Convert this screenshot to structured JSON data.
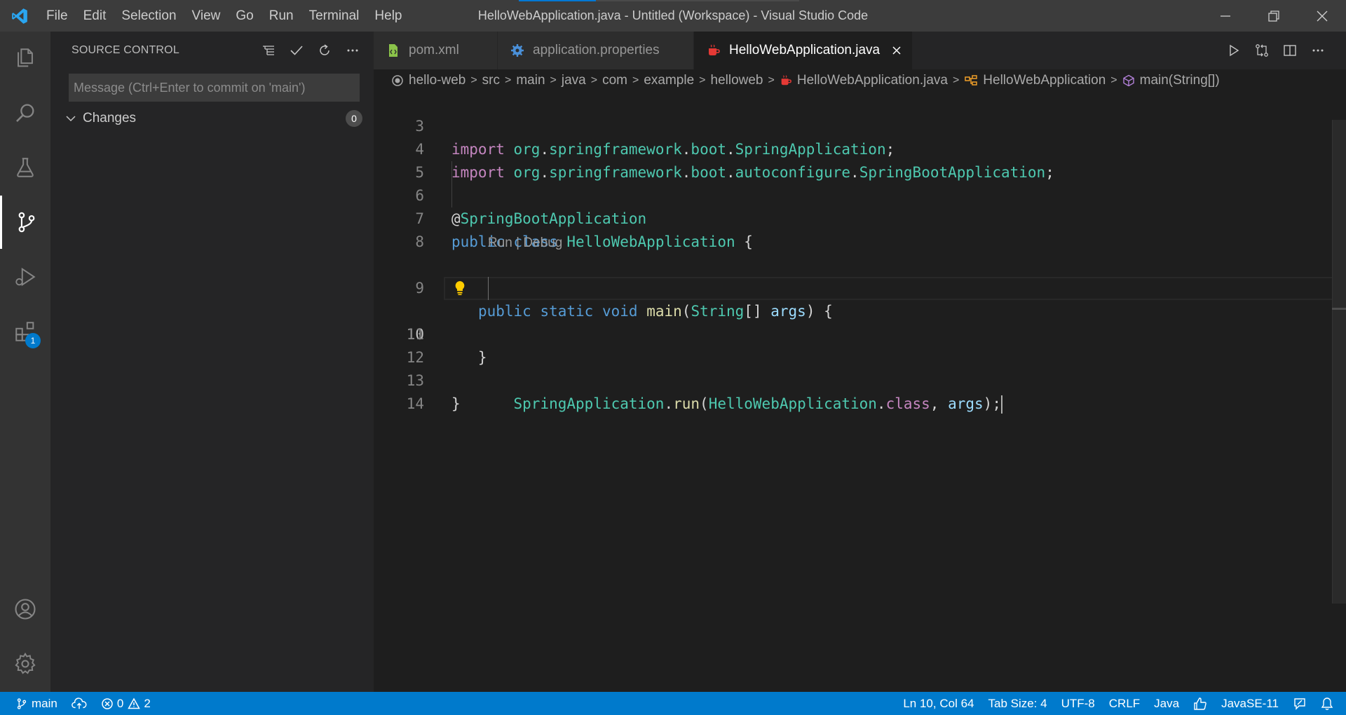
{
  "window": {
    "title": "HelloWebApplication.java - Untitled (Workspace) - Visual Studio Code",
    "menu": [
      "File",
      "Edit",
      "Selection",
      "View",
      "Go",
      "Run",
      "Terminal",
      "Help"
    ]
  },
  "activity_bar": {
    "extensions_badge": "1"
  },
  "sidebar": {
    "title": "SOURCE CONTROL",
    "commit_placeholder": "Message (Ctrl+Enter to commit on 'main')",
    "changes_label": "Changes",
    "changes_count": "0"
  },
  "tabs": [
    {
      "label": "pom.xml",
      "icon": "xml-file-icon"
    },
    {
      "label": "application.properties",
      "icon": "gear-icon"
    },
    {
      "label": "HelloWebApplication.java",
      "icon": "java-file-icon",
      "active": true
    }
  ],
  "breadcrumbs": [
    "hello-web",
    "src",
    "main",
    "java",
    "com",
    "example",
    "helloweb",
    "HelloWebApplication.java",
    "HelloWebApplication",
    "main(String[])"
  ],
  "editor": {
    "line_numbers": [
      "3",
      "4",
      "5",
      "6",
      "7",
      "8",
      "9",
      "10",
      "11",
      "12",
      "13",
      "14"
    ],
    "codelens": "Run | Debug",
    "current_line": "10"
  },
  "status": {
    "branch": "main",
    "errors": "0",
    "warnings": "2",
    "position": "Ln 10, Col 64",
    "tab_size": "Tab Size: 4",
    "encoding": "UTF-8",
    "eol": "CRLF",
    "language": "Java",
    "runtime": "JavaSE-11"
  },
  "colors": {
    "accent": "#007acc",
    "keyword": "#569cd6",
    "type": "#4ec9b0",
    "function": "#dcdcaa",
    "variable": "#9cdcfe"
  }
}
